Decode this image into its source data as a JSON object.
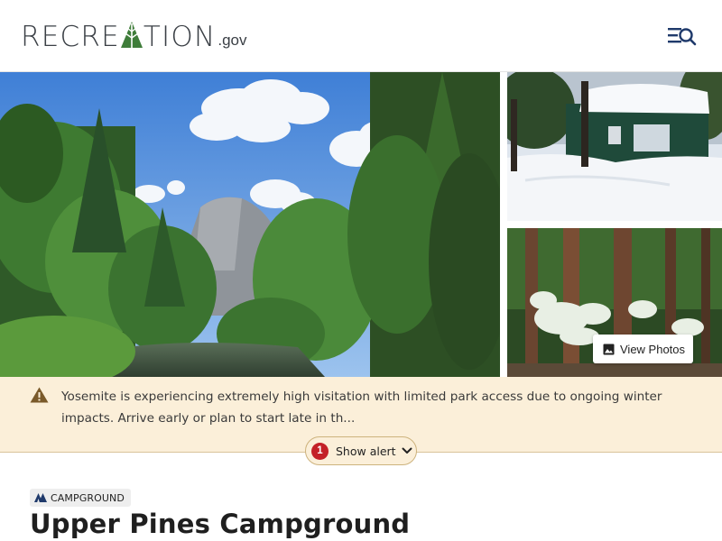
{
  "header": {
    "logo_text_before": "RECRE",
    "logo_text_after": "TION",
    "logo_suffix": ".gov",
    "menu_icon": "menu-search-icon"
  },
  "gallery": {
    "view_photos_label": "View Photos",
    "view_photos_icon": "image-icon"
  },
  "alert": {
    "icon": "warning-icon",
    "text": "Yosemite is experiencing extremely high visitation with limited park access due to ongoing winter impacts. Arrive early or plan to start late in th...",
    "count": "1",
    "toggle_label": "Show alert",
    "toggle_icon": "chevron-down-icon",
    "colors": {
      "background": "#fbefd9",
      "count_badge": "#c42127"
    }
  },
  "facility": {
    "type_label": "CAMPGROUND",
    "type_icon": "tent-icon",
    "title": "Upper Pines Campground"
  },
  "colors": {
    "brand_navy": "#1f3a6b",
    "logo_green": "#3f7d3a"
  }
}
